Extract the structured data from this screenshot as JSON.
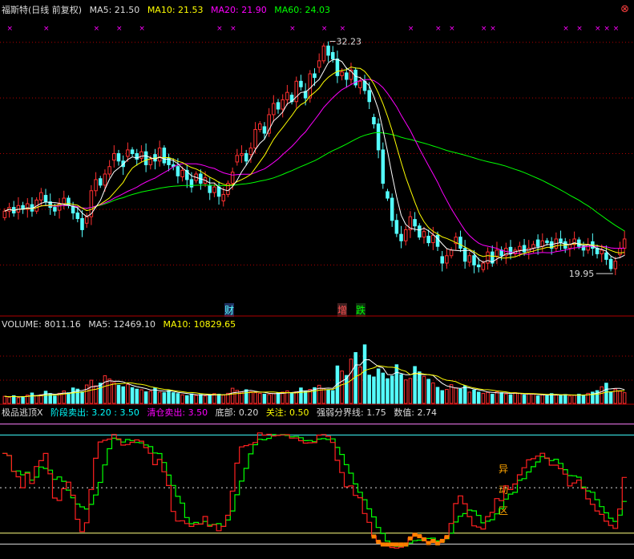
{
  "header": {
    "stock": "福斯特(日线 前复权)",
    "ma5": "MA5: 21.50",
    "ma10": "MA10: 21.53",
    "ma20": "MA20: 21.90",
    "ma60": "MA60: 24.03"
  },
  "volume_header": {
    "volume": "VOLUME: 8011.16",
    "ma5": "MA5: 12469.10",
    "ma10": "MA10: 10829.65"
  },
  "indicator_header": {
    "name": "极品逃顶X",
    "stage_sell": "阶段卖出: 3.20 : 3.50",
    "clear_sell": "清仓卖出: 3.50",
    "bottom": "底部: 0.20",
    "watch": "关注: 0.50",
    "strength": "强弱分界线: 1.75",
    "value": "数值: 2.74"
  },
  "markers": {
    "cai": "财",
    "zeng": "增",
    "die": "跌",
    "yi_dong_qu": [
      "异",
      "动",
      "区"
    ]
  },
  "colors": {
    "up": "#ff3030",
    "down": "#54ffff",
    "ma5": "#ffffff",
    "ma10": "#ffff00",
    "ma20": "#ff00ff",
    "ma60": "#00ff00",
    "grid": "#b00000"
  },
  "chart_data": [
    {
      "type": "candlestick",
      "annotations": {
        "high_label": "32.23",
        "low_label": "19.95"
      },
      "ylim": [
        18.2,
        33.5
      ],
      "grid_values": [
        20,
        23,
        26,
        29,
        32
      ],
      "closes": [
        22.9,
        23.1,
        22.8,
        23.2,
        23.0,
        23.3,
        22.9,
        23.5,
        23.9,
        23.4,
        23.1,
        22.9,
        23.3,
        23.6,
        23.2,
        22.8,
        22.5,
        21.9,
        22.6,
        24.0,
        24.6,
        24.3,
        24.9,
        25.3,
        26.0,
        25.6,
        25.3,
        26.2,
        26.0,
        25.7,
        26.1,
        25.4,
        25.7,
        25.6,
        26.3,
        25.5,
        25.4,
        25.3,
        24.8,
        25.1,
        24.6,
        24.2,
        24.9,
        24.4,
        24.7,
        23.9,
        24.2,
        23.7,
        23.8,
        24.4,
        25.0,
        25.9,
        26.0,
        25.6,
        26.3,
        27.3,
        27.6,
        27.1,
        28.1,
        28.7,
        28.4,
        28.9,
        29.3,
        28.8,
        29.9,
        29.6,
        29.0,
        30.3,
        30.1,
        31.0,
        31.8,
        31.3,
        31.1,
        30.2,
        30.4,
        30.0,
        30.5,
        29.7,
        29.9,
        29.4,
        28.8,
        27.6,
        26.2,
        24.4,
        23.6,
        22.4,
        21.7,
        21.3,
        21.9,
        22.6,
        22.1,
        21.5,
        21.8,
        21.2,
        21.6,
        21.0,
        20.1,
        20.5,
        20.8,
        21.5,
        20.9,
        20.2,
        20.5,
        20.0,
        19.9,
        20.1,
        20.7,
        20.1,
        20.8,
        20.5,
        20.9,
        20.6,
        20.8,
        21.0,
        20.7,
        20.9,
        21.1,
        21.0,
        21.3,
        21.2,
        20.9,
        21.4,
        21.2,
        20.9,
        21.1,
        21.4,
        21.0,
        20.8,
        21.1,
        20.9,
        20.6,
        20.8,
        20.3,
        19.8,
        20.2,
        20.9,
        21.4
      ],
      "ma_series": [
        "MA5",
        "MA10",
        "MA20",
        "MA60"
      ]
    },
    {
      "type": "bar",
      "ylim": [
        0,
        24000
      ],
      "volumes": [
        2400,
        2100,
        2600,
        1900,
        2300,
        2800,
        3500,
        2600,
        2900,
        4100,
        3300,
        2500,
        3400,
        4200,
        3600,
        5200,
        4800,
        3900,
        6200,
        7800,
        5900,
        6800,
        9300,
        8200,
        7000,
        6100,
        5600,
        6400,
        5300,
        4800,
        4600,
        3900,
        4100,
        5200,
        3800,
        3600,
        4300,
        3600,
        3300,
        2900,
        2600,
        3200,
        2700,
        3000,
        2500,
        2700,
        3300,
        3100,
        2800,
        3400,
        5100,
        4400,
        3800,
        4600,
        3900,
        3600,
        3400,
        3100,
        3000,
        3300,
        3600,
        3800,
        4200,
        3500,
        3900,
        5200,
        4200,
        4700,
        5300,
        6100,
        5000,
        4600,
        4300,
        12600,
        10900,
        9400,
        14900,
        17100,
        12300,
        19700,
        9500,
        8900,
        11600,
        10200,
        8300,
        9200,
        13000,
        9700,
        7900,
        8400,
        12400,
        10600,
        9100,
        8100,
        6900,
        5400,
        4300,
        4700,
        6300,
        5200,
        4800,
        5900,
        3800,
        4500,
        3800,
        3400,
        3700,
        3100,
        3900,
        3600,
        3200,
        2900,
        3600,
        3400,
        2800,
        3200,
        3100,
        2500,
        2900,
        2600,
        3300,
        2800,
        2700,
        3000,
        2500,
        2800,
        3100,
        2600,
        3400,
        3800,
        4300,
        5600,
        6800,
        3900,
        4800,
        4100,
        3600
      ]
    },
    {
      "type": "line",
      "levels": {
        "stage_sell": 3.2,
        "clear_sell": 3.5,
        "strength": 1.75,
        "watch": 0.5,
        "bottom": 0.2
      },
      "ylim": [
        -0.1,
        3.65
      ],
      "value": 2.74
    }
  ]
}
